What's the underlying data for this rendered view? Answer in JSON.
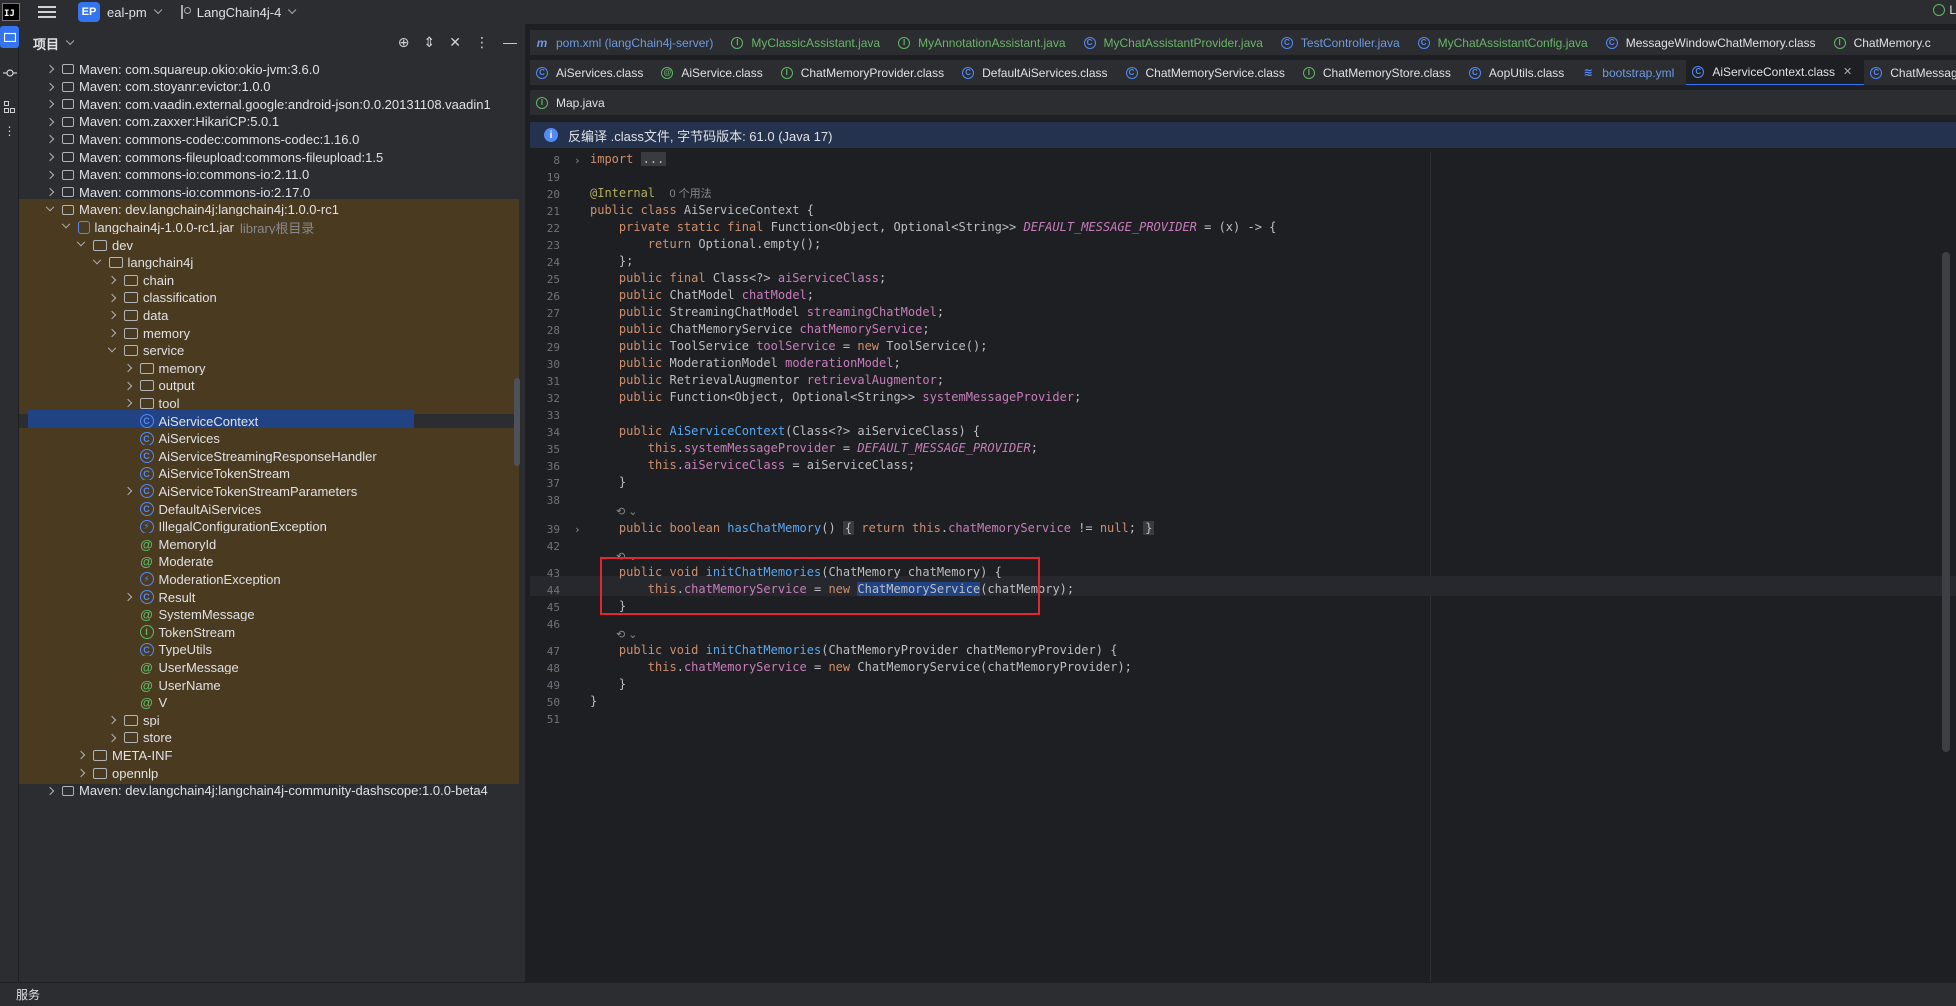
{
  "titlebar": {
    "logo": "IJ",
    "project_badge": "EP",
    "project_name": "eal-pm",
    "branch": "LangChain4j-4",
    "right_text": "L"
  },
  "toolstrip": {
    "icons": [
      "folder-icon",
      "commit-icon",
      "structure-icon",
      "more-icon"
    ],
    "more_label": "⋮"
  },
  "project_panel": {
    "title": "项目",
    "tree": [
      {
        "label": "Maven: com.squareup.okio:okio-jvm:3.6.0",
        "type": "lib",
        "indent": 1,
        "arrow": "right"
      },
      {
        "label": "Maven: com.stoyanr:evictor:1.0.0",
        "type": "lib",
        "indent": 1,
        "arrow": "right"
      },
      {
        "label": "Maven: com.vaadin.external.google:android-json:0.0.20131108.vaadin1",
        "type": "lib",
        "indent": 1,
        "arrow": "right"
      },
      {
        "label": "Maven: com.zaxxer:HikariCP:5.0.1",
        "type": "lib",
        "indent": 1,
        "arrow": "right"
      },
      {
        "label": "Maven: commons-codec:commons-codec:1.16.0",
        "type": "lib",
        "indent": 1,
        "arrow": "right"
      },
      {
        "label": "Maven: commons-fileupload:commons-fileupload:1.5",
        "type": "lib",
        "indent": 1,
        "arrow": "right"
      },
      {
        "label": "Maven: commons-io:commons-io:2.11.0",
        "type": "lib",
        "indent": 1,
        "arrow": "right"
      },
      {
        "label": "Maven: commons-io:commons-io:2.17.0",
        "type": "lib",
        "indent": 1,
        "arrow": "right"
      },
      {
        "label": "Maven: dev.langchain4j:langchain4j:1.0.0-rc1",
        "type": "lib",
        "indent": 1,
        "arrow": "down"
      },
      {
        "label": "langchain4j-1.0.0-rc1.jar",
        "hint": "library根目录",
        "type": "jar",
        "indent": 2,
        "arrow": "down"
      },
      {
        "label": "dev",
        "type": "folder",
        "indent": 3,
        "arrow": "down"
      },
      {
        "label": "langchain4j",
        "type": "folder",
        "indent": 4,
        "arrow": "down"
      },
      {
        "label": "chain",
        "type": "folder",
        "indent": 5,
        "arrow": "right"
      },
      {
        "label": "classification",
        "type": "folder",
        "indent": 5,
        "arrow": "right"
      },
      {
        "label": "data",
        "type": "folder",
        "indent": 5,
        "arrow": "right"
      },
      {
        "label": "memory",
        "type": "folder",
        "indent": 5,
        "arrow": "right"
      },
      {
        "label": "service",
        "type": "folder",
        "indent": 5,
        "arrow": "down"
      },
      {
        "label": "memory",
        "type": "folder",
        "indent": 6,
        "arrow": "right"
      },
      {
        "label": "output",
        "type": "folder",
        "indent": 6,
        "arrow": "right"
      },
      {
        "label": "tool",
        "type": "folder",
        "indent": 6,
        "arrow": "right"
      },
      {
        "label": "AiServiceContext",
        "type": "c",
        "indent": 6,
        "arrow": "none",
        "selected": true
      },
      {
        "label": "AiServices",
        "type": "c",
        "indent": 6,
        "arrow": "none"
      },
      {
        "label": "AiServiceStreamingResponseHandler",
        "type": "c",
        "indent": 6,
        "arrow": "none"
      },
      {
        "label": "AiServiceTokenStream",
        "type": "c",
        "indent": 6,
        "arrow": "none"
      },
      {
        "label": "AiServiceTokenStreamParameters",
        "type": "c",
        "indent": 6,
        "arrow": "right"
      },
      {
        "label": "DefaultAiServices",
        "type": "c",
        "indent": 6,
        "arrow": "none"
      },
      {
        "label": "IllegalConfigurationException",
        "type": "e",
        "indent": 6,
        "arrow": "none"
      },
      {
        "label": "MemoryId",
        "type": "at",
        "indent": 6,
        "arrow": "none"
      },
      {
        "label": "Moderate",
        "type": "at",
        "indent": 6,
        "arrow": "none"
      },
      {
        "label": "ModerationException",
        "type": "e",
        "indent": 6,
        "arrow": "none"
      },
      {
        "label": "Result",
        "type": "c",
        "indent": 6,
        "arrow": "right"
      },
      {
        "label": "SystemMessage",
        "type": "at",
        "indent": 6,
        "arrow": "none"
      },
      {
        "label": "TokenStream",
        "type": "i",
        "indent": 6,
        "arrow": "none"
      },
      {
        "label": "TypeUtils",
        "type": "c",
        "indent": 6,
        "arrow": "none"
      },
      {
        "label": "UserMessage",
        "type": "at",
        "indent": 6,
        "arrow": "none"
      },
      {
        "label": "UserName",
        "type": "at",
        "indent": 6,
        "arrow": "none"
      },
      {
        "label": "V",
        "type": "at",
        "indent": 6,
        "arrow": "none"
      },
      {
        "label": "spi",
        "type": "folder",
        "indent": 5,
        "arrow": "right"
      },
      {
        "label": "store",
        "type": "folder",
        "indent": 5,
        "arrow": "right"
      },
      {
        "label": "META-INF",
        "type": "folder",
        "indent": 3,
        "arrow": "right"
      },
      {
        "label": "opennlp",
        "type": "folder",
        "indent": 3,
        "arrow": "right"
      },
      {
        "label": "Maven: dev.langchain4j:langchain4j-community-dashscope:1.0.0-beta4",
        "type": "lib",
        "indent": 1,
        "arrow": "right"
      }
    ]
  },
  "tabs_row1": [
    {
      "label": "pom.xml (langChain4j-server)",
      "icon": "m",
      "color": "blue"
    },
    {
      "label": "MyClassicAssistant.java",
      "icon": "i",
      "color": "green"
    },
    {
      "label": "MyAnnotationAssistant.java",
      "icon": "i",
      "color": "green"
    },
    {
      "label": "MyChatAssistantProvider.java",
      "icon": "c",
      "color": "green"
    },
    {
      "label": "TestController.java",
      "icon": "c",
      "color": "blue"
    },
    {
      "label": "MyChatAssistantConfig.java",
      "icon": "c",
      "color": "green"
    },
    {
      "label": "MessageWindowChatMemory.class",
      "icon": "c",
      "color": "normal"
    },
    {
      "label": "ChatMemory.c",
      "icon": "i",
      "color": "normal"
    }
  ],
  "tabs_row2": [
    {
      "label": "AiServices.class",
      "icon": "c",
      "color": "normal"
    },
    {
      "label": "AiService.class",
      "icon": "at",
      "color": "normal"
    },
    {
      "label": "ChatMemoryProvider.class",
      "icon": "i",
      "color": "normal"
    },
    {
      "label": "DefaultAiServices.class",
      "icon": "c",
      "color": "normal"
    },
    {
      "label": "ChatMemoryService.class",
      "icon": "c",
      "color": "normal"
    },
    {
      "label": "ChatMemoryStore.class",
      "icon": "i",
      "color": "normal"
    },
    {
      "label": "AopUtils.class",
      "icon": "c",
      "color": "normal"
    },
    {
      "label": "bootstrap.yml",
      "icon": "y",
      "color": "blue"
    },
    {
      "label": "AiServiceContext.class",
      "icon": "c",
      "color": "normal",
      "active": true
    },
    {
      "label": "ChatMessage",
      "icon": "c",
      "color": "normal"
    }
  ],
  "tabs_row3": [
    {
      "label": "Map.java",
      "icon": "i",
      "color": "normal"
    }
  ],
  "banner": {
    "text": "反编译 .class文件, 字节码版本: 61.0 (Java 17)"
  },
  "code": {
    "line_numbers": [
      "8",
      "19",
      "20",
      "21",
      "22",
      "23",
      "24",
      "25",
      "26",
      "27",
      "28",
      "29",
      "30",
      "31",
      "32",
      "33",
      "34",
      "35",
      "36",
      "37",
      "38",
      "",
      "39",
      "42",
      "",
      "43",
      "44",
      "45",
      "46",
      "",
      "47",
      "48",
      "49",
      "50",
      "51"
    ],
    "usage_hint": "0 个用法",
    "import_kw": "import",
    "import_fold": "...",
    "annotation": "@Internal",
    "edit_marker": "⟲ ⌄"
  },
  "statusbar": {
    "label": "服务"
  },
  "colors": {
    "accent": "#3574f0",
    "selection": "#214283",
    "library_bg": "#4a3a1f",
    "highlight_box": "#e0282e"
  }
}
